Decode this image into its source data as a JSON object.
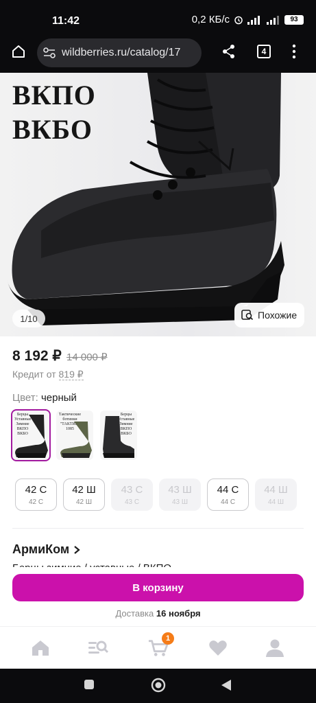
{
  "status": {
    "time": "11:42",
    "speed": "0,2 КБ/с",
    "battery": "93"
  },
  "browser": {
    "url": "wildberries.ru/catalog/17",
    "tab_count": "4"
  },
  "hero": {
    "title_line1": "ВКПО",
    "title_line2": "ВКБО",
    "counter": "1/10",
    "similar_label": "Похожие"
  },
  "product": {
    "price": "8 192 ₽",
    "old_price": "14 000 ₽",
    "credit_label": "Кредит от",
    "credit_value": "819 ₽",
    "color_label": "Цвет:",
    "color_value": "черный",
    "brand": "АрмиКом",
    "name": "Берцы зимние / уставные / ВКПО"
  },
  "thumbnails": [
    {
      "caption": "Берцы Уставные Зимние ВКПО ВКБО",
      "selected": true
    },
    {
      "caption": "Тактические ботинки \"ТАКТИК\" 1085",
      "selected": false
    },
    {
      "caption": "Берцы Уставные Зимние ВКПО ВКБО",
      "selected": false
    }
  ],
  "sizes": [
    {
      "main": "42 С",
      "sub": "42 С",
      "available": true
    },
    {
      "main": "42 Ш",
      "sub": "42 Ш",
      "available": true
    },
    {
      "main": "43 С",
      "sub": "43 С",
      "available": false
    },
    {
      "main": "43 Ш",
      "sub": "43 Ш",
      "available": false
    },
    {
      "main": "44 С",
      "sub": "44 С",
      "available": true
    },
    {
      "main": "44 Ш",
      "sub": "44 Ш",
      "available": false
    }
  ],
  "cta": {
    "cart_label": "В корзину",
    "delivery_label": "Доставка",
    "delivery_date": "16 ноября"
  },
  "tabbar": {
    "cart_badge": "1",
    "icons": [
      "home-icon",
      "catalog-search-icon",
      "cart-icon",
      "heart-icon",
      "profile-icon"
    ]
  },
  "colors": {
    "accent": "#cb11ab",
    "badge": "#f57c18"
  }
}
